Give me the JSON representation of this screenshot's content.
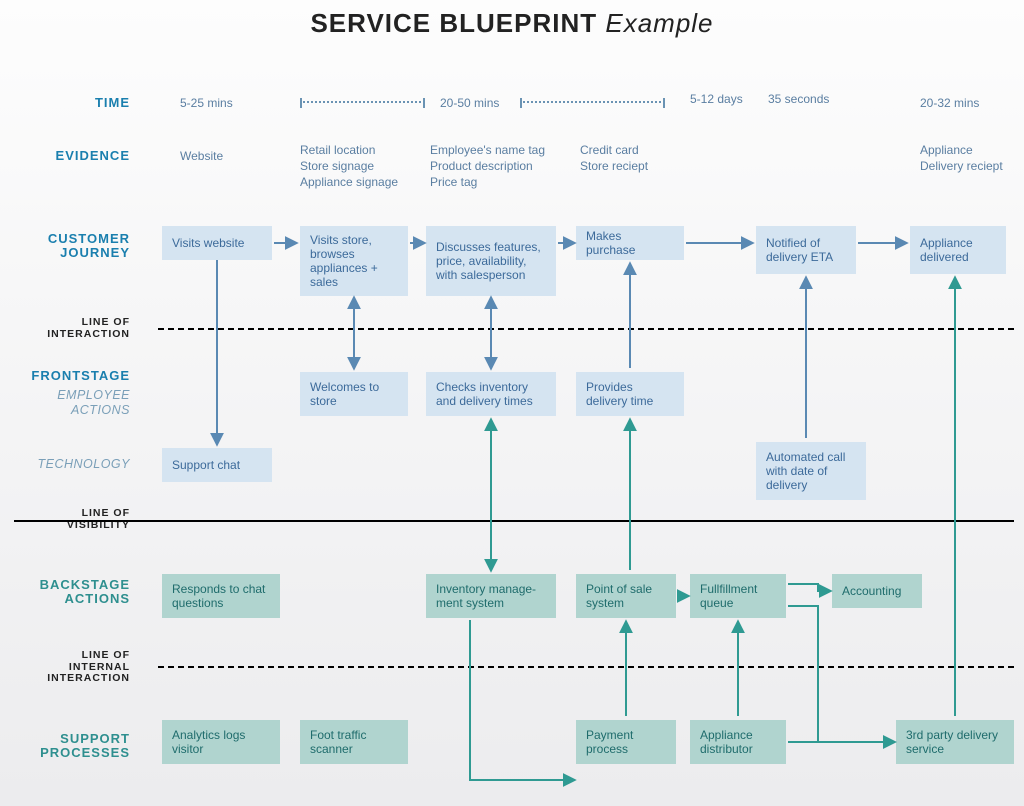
{
  "title_bold": "SERVICE BLUEPRINT",
  "title_light": " Example",
  "labels": {
    "time": "TIME",
    "evidence": "EVIDENCE",
    "journey_a": "CUSTOMER",
    "journey_b": "JOURNEY",
    "line_interaction_a": "LINE OF",
    "line_interaction_b": "INTERACTION",
    "frontstage": "FRONTSTAGE",
    "employee": "EMPLOYEE ACTIONS",
    "technology": "TECHNOLOGY",
    "line_visibility_a": "LINE OF",
    "line_visibility_b": "VISIBILITY",
    "backstage_a": "BACKSTAGE",
    "backstage_b": "ACTIONS",
    "line_internal_a": "LINE OF",
    "line_internal_b": "INTERNAL",
    "line_internal_c": "INTERACTION",
    "support_a": "SUPPORT",
    "support_b": "PROCESSES"
  },
  "time": {
    "c1": "5-25 mins",
    "c2": "20-50 mins",
    "c5": "5-12 days",
    "c6": "35 seconds",
    "c7": "20-32 mins"
  },
  "evidence": {
    "c1": "Website",
    "c2": "Retail location\nStore signage\nAppliance signage",
    "c3": "Employee's name tag\nProduct description\nPrice tag",
    "c4": "Credit card\nStore reciept",
    "c7": "Appliance\nDelivery reciept"
  },
  "journey": {
    "c1": "Visits website",
    "c2": "Visits store, browses appliances + sales",
    "c3": "Discusses features, price, availability, with salesperson",
    "c4": "Makes purchase",
    "c6": "Notified of delivery ETA",
    "c7": "Appliance delivered"
  },
  "employee": {
    "c2": "Welcomes to store",
    "c3": "Checks inventory and delivery times",
    "c4": "Provides delivery time"
  },
  "technology": {
    "c1": "Support chat",
    "c6": "Automated call with date of delivery"
  },
  "backstage": {
    "c1": "Responds to chat questions",
    "c3": "Inventory manage- ment system",
    "c4": "Point of sale system",
    "c5": "Fullfillment queue",
    "c6": "Accounting"
  },
  "support": {
    "c1": "Analytics logs visitor",
    "c2": "Foot traffic scanner",
    "c4": "Payment process",
    "c5": "Appliance distributor",
    "c7": "3rd party delivery service"
  }
}
